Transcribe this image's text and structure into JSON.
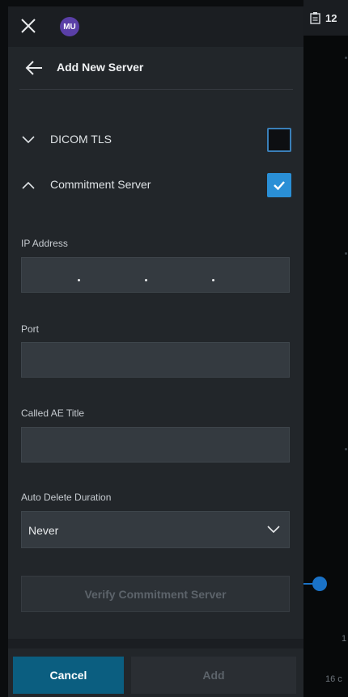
{
  "header": {
    "avatar_initials": "MU",
    "title": "Add New Server"
  },
  "sections": {
    "dicom_tls": {
      "label": "DICOM TLS",
      "checked": false
    },
    "commitment_server": {
      "label": "Commitment Server",
      "checked": true
    }
  },
  "form": {
    "ip_address": {
      "label": "IP Address",
      "value": ""
    },
    "port": {
      "label": "Port",
      "value": ""
    },
    "called_ae_title": {
      "label": "Called AE Title",
      "value": ""
    },
    "auto_delete_duration": {
      "label": "Auto Delete Duration",
      "value": "Never"
    },
    "verify_button": "Verify Commitment Server"
  },
  "footer": {
    "cancel_label": "Cancel",
    "add_label": "Add"
  },
  "background": {
    "notification_count": "12",
    "text_1": "1",
    "text_2": "16 c"
  },
  "colors": {
    "accent": "#2a8fd6",
    "primary_button": "#0b5e80",
    "avatar": "#5a3fa7"
  }
}
